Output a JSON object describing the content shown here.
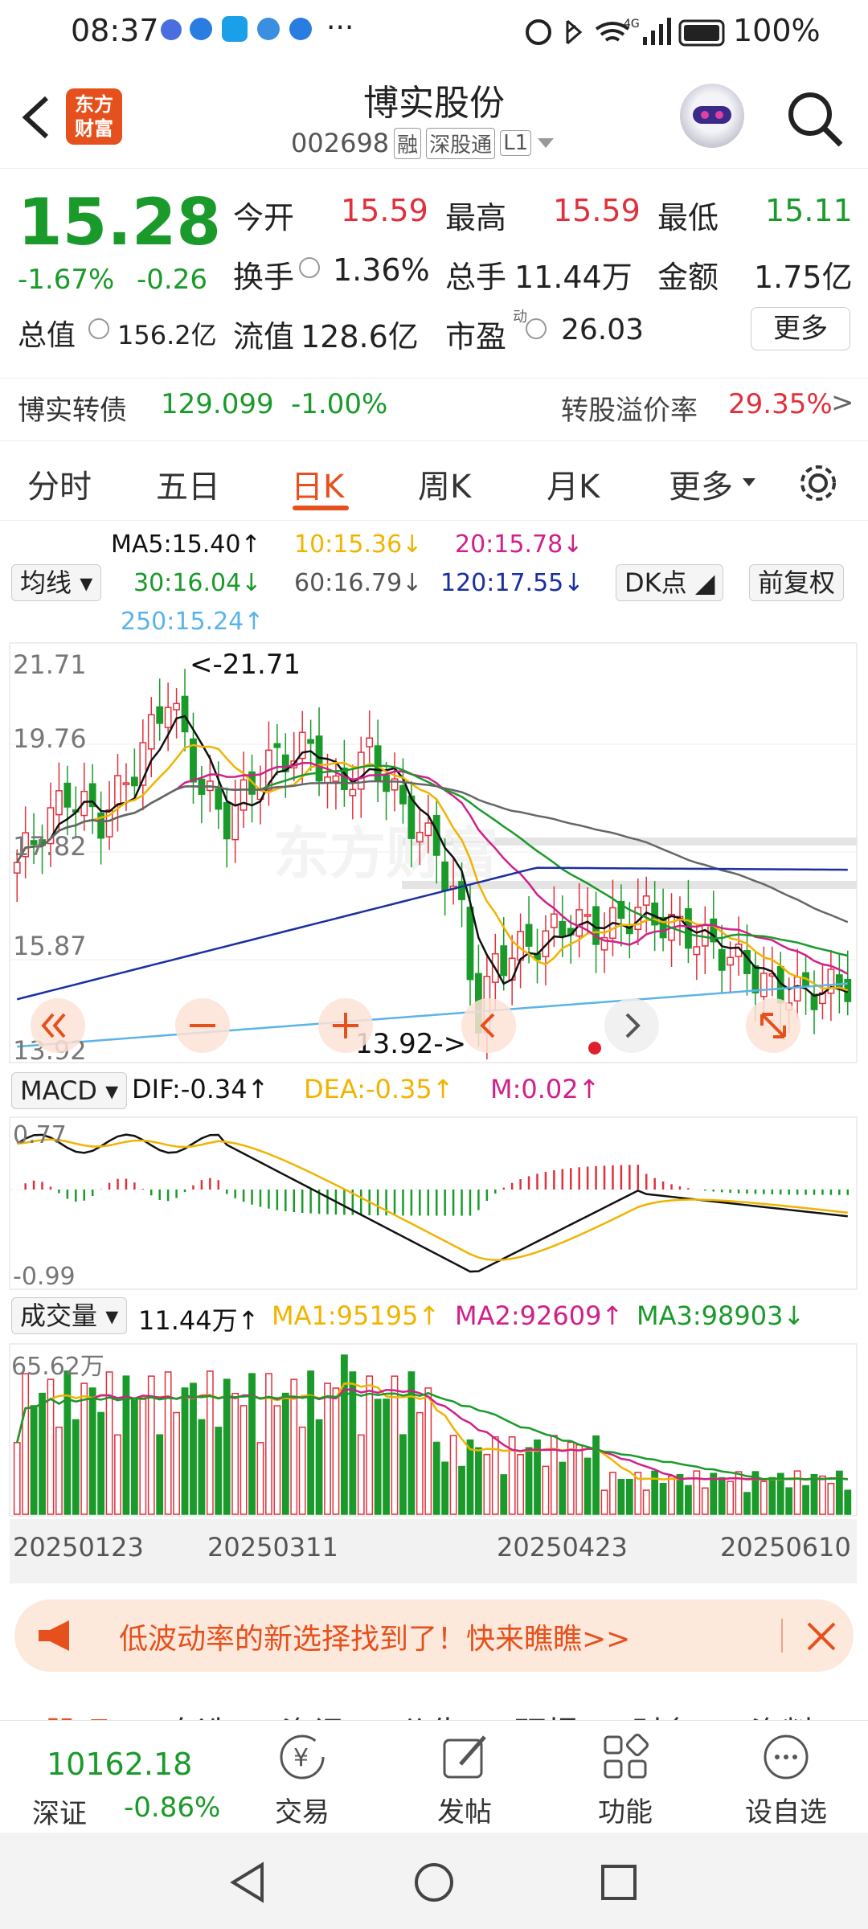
{
  "status": {
    "time": "08:37",
    "dots": "···",
    "battery": "100%",
    "network": "4G"
  },
  "header": {
    "logo_line1": "东方",
    "logo_line2": "财富",
    "stock_name": "博实股份",
    "stock_code": "002698",
    "tag_margin": "融",
    "tag_connect": "深股通",
    "tag_level": "L1"
  },
  "quote": {
    "price": "15.28",
    "change_pct": "-1.67%",
    "change": "-0.26",
    "open_label": "今开",
    "open": "15.59",
    "high_label": "最高",
    "high": "15.59",
    "low_label": "最低",
    "low": "15.11",
    "turnover_label": "换手",
    "turnover": "1.36%",
    "volume_label": "总手",
    "volume": "11.44万",
    "amount_label": "金额",
    "amount": "1.75亿",
    "mktcap_label": "总值",
    "mktcap": "156.2亿",
    "float_label": "流值",
    "float": "128.6亿",
    "pe_label": "市盈",
    "pe_sup": "动",
    "pe": "26.03",
    "more_label": "更多"
  },
  "bond": {
    "name": "博实转债",
    "price": "129.099",
    "change": "-1.00%",
    "premium_label": "转股溢价率",
    "premium": "29.35%",
    "arrow": ">"
  },
  "tabs": [
    {
      "label": "分时"
    },
    {
      "label": "五日"
    },
    {
      "label": "日K"
    },
    {
      "label": "周K"
    },
    {
      "label": "月K"
    },
    {
      "label": "更多"
    }
  ],
  "ma": {
    "selector": "均线",
    "ma5": "MA5:15.40↑",
    "ma10": "10:15.36↓",
    "ma20": "20:15.78↓",
    "ma30": "30:16.04↓",
    "ma60": "60:16.79↓",
    "ma120": "120:17.55↓",
    "ma250": "250:15.24↑",
    "dk": "DK点",
    "adj": "前复权"
  },
  "kline": {
    "y_top": "21.71",
    "y_2": "19.76",
    "y_3": "17.82",
    "y_4": "15.87",
    "y_bottom": "13.92",
    "high_marker": "<-21.71",
    "low_marker": "13.92->"
  },
  "macd": {
    "selector": "MACD",
    "dif": "DIF:-0.34↑",
    "dea": "DEA:-0.35↑",
    "m": "M:0.02↑",
    "y_top": "0.77",
    "y_bottom": "-0.99"
  },
  "vol": {
    "selector": "成交量",
    "vol": "11.44万↑",
    "ma1": "MA1:95195↑",
    "ma2": "MA2:92609↑",
    "ma3": "MA3:98903↓",
    "y_top": "65.62万"
  },
  "dates": [
    "20250123",
    "20250311",
    "20250423",
    "20250610"
  ],
  "banner": {
    "text": "低波动率的新选择找到了！快来瞧瞧>>"
  },
  "section_tabs": [
    "股吧",
    "自选",
    "资讯",
    "公告",
    "研报",
    "财务",
    "资料"
  ],
  "index": {
    "value": "10162.18",
    "name": "深证",
    "change": "-0.86%"
  },
  "bottom_nav": [
    {
      "label": "交易"
    },
    {
      "label": "发帖"
    },
    {
      "label": "功能"
    },
    {
      "label": "设自选"
    }
  ],
  "colors": {
    "up": "#e0303c",
    "down": "#1a9a2a",
    "accent": "#e5501c",
    "ma5": "#111111",
    "ma10": "#f0b400",
    "ma20": "#d0208a",
    "ma30": "#1a9a2a",
    "ma60": "#666666",
    "ma120": "#1a2fa0",
    "ma250": "#5ab4e8"
  }
}
